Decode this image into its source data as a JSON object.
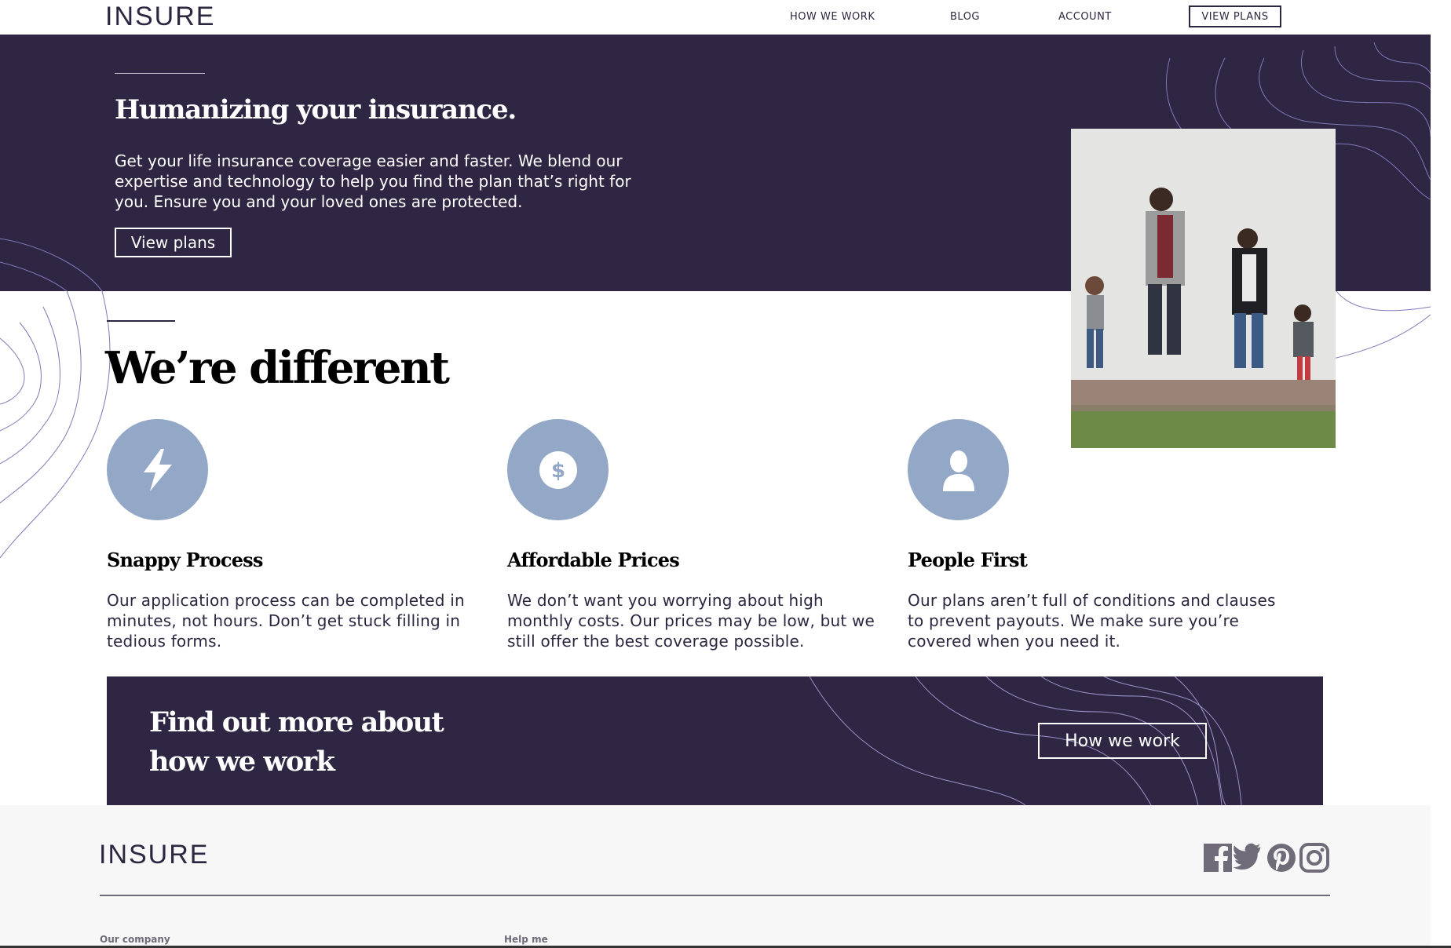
{
  "header": {
    "logo": "INSURE",
    "nav": [
      "HOW WE WORK",
      "BLOG",
      "ACCOUNT"
    ],
    "cta": "VIEW PLANS"
  },
  "hero": {
    "title": "Humanizing your insurance.",
    "text": "Get your life insurance coverage easier and faster. We blend our expertise and technology to help you find the plan that’s right for you. Ensure you and your loved ones are protected.",
    "button": "View plans"
  },
  "different": {
    "title": "We’re different",
    "features": [
      {
        "icon": "lightning-icon",
        "title": "Snappy Process",
        "text": "Our application process can be completed in minutes, not hours. Don’t get stuck filling in tedious forms."
      },
      {
        "icon": "dollar-icon",
        "title": "Affordable Prices",
        "text": "We don’t want you worrying about high monthly costs. Our prices may be low, but we still offer the best coverage possible."
      },
      {
        "icon": "person-icon",
        "title": "People First",
        "text": "Our plans aren’t full of conditions and clauses to prevent payouts. We make sure you’re covered when you need it."
      }
    ]
  },
  "cta": {
    "title": "Find out more about how we work",
    "button": "How we work"
  },
  "footer": {
    "logo": "INSURE",
    "social": [
      "facebook-icon",
      "twitter-icon",
      "pinterest-icon",
      "instagram-icon"
    ],
    "columns": [
      "Our company",
      "Help me"
    ]
  },
  "colors": {
    "dark_violet": "#2e2642",
    "icon_circle": "#93a8c6",
    "footer_bg": "#f7f7f7"
  }
}
